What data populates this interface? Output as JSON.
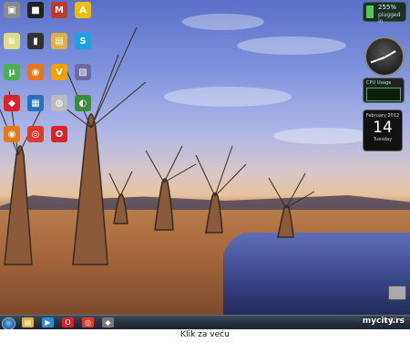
{
  "desktop": {
    "icons": [
      {
        "name": "folder-icon",
        "glyph": "▣",
        "color": "#8a8a8a"
      },
      {
        "name": "app-icon-black",
        "glyph": "■",
        "color": "#222"
      },
      {
        "name": "m-app-icon",
        "glyph": "M",
        "color": "#c0392b"
      },
      {
        "name": "avast-icon",
        "glyph": "A",
        "color": "#e8c200"
      },
      {
        "name": "notes-icon",
        "glyph": "≡",
        "color": "#dddd88"
      },
      {
        "name": "book-icon",
        "glyph": "▮",
        "color": "#333"
      },
      {
        "name": "folder-yellow-icon",
        "glyph": "▤",
        "color": "#e0b040"
      },
      {
        "name": "skype-icon",
        "glyph": "S",
        "color": "#1aa3e0"
      },
      {
        "name": "utorrent-icon",
        "glyph": "µ",
        "color": "#4caf50"
      },
      {
        "name": "firefox-icon",
        "glyph": "◉",
        "color": "#e8771a"
      },
      {
        "name": "v-app-icon",
        "glyph": "V",
        "color": "#f0a000"
      },
      {
        "name": "document-icon",
        "glyph": "▧",
        "color": "#6a6aa8"
      },
      {
        "name": "opera-red-icon",
        "glyph": "◆",
        "color": "#d8232a"
      },
      {
        "name": "network-icon",
        "glyph": "▦",
        "color": "#2a6fb8"
      },
      {
        "name": "disc-icon",
        "glyph": "◍",
        "color": "#bbb"
      },
      {
        "name": "chrome-small-icon",
        "glyph": "◐",
        "color": "#3a8e3a"
      },
      {
        "name": "firefox-2-icon",
        "glyph": "◉",
        "color": "#e8771a"
      },
      {
        "name": "chrome-icon",
        "glyph": "◎",
        "color": "#dd3b2c"
      },
      {
        "name": "opera-icon",
        "glyph": "O",
        "color": "#d8232a"
      }
    ]
  },
  "gadgets": {
    "battery": {
      "percent": "255%",
      "state": "plugged in",
      "level": 1.0
    },
    "cpu": {
      "label": "CPU Usage"
    },
    "calendar": {
      "month": "February 2012",
      "day": "14",
      "weekday": "Tuesday"
    }
  },
  "taskbar": {
    "apps": [
      {
        "name": "taskbar-folder-icon",
        "glyph": "▤",
        "color": "#e0b040"
      },
      {
        "name": "taskbar-media-icon",
        "glyph": "▶",
        "color": "#2a8ed8"
      },
      {
        "name": "taskbar-opera-icon",
        "glyph": "O",
        "color": "#d8232a"
      },
      {
        "name": "taskbar-chrome-icon",
        "glyph": "◎",
        "color": "#dd3b2c"
      },
      {
        "name": "taskbar-app-icon",
        "glyph": "◆",
        "color": "#777"
      }
    ]
  },
  "caption": {
    "text": "Klik za veću",
    "watermark": "mycity.rs"
  }
}
